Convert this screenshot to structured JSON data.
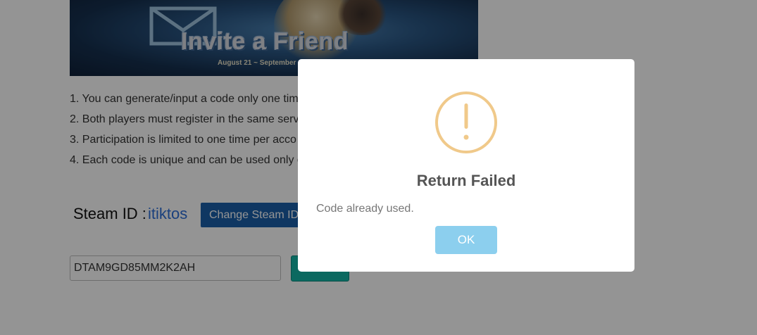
{
  "banner": {
    "title": "Invite a Friend",
    "date": "August 21 ~ September"
  },
  "rules": [
    "1. You can generate/input a code only one tim",
    "2. Both players must register in the same serv",
    "3. Participation is limited to one time per acco",
    "4. Each code is unique and can be used only o"
  ],
  "steam": {
    "label": "Steam ID :",
    "value": "itiktos",
    "change_button": "Change Steam ID"
  },
  "code_input": {
    "value": "DTAM9GD85MM2K2AH"
  },
  "modal": {
    "icon": "warning-exclamation-icon",
    "title": "Return Failed",
    "message": "Code already used.",
    "ok_label": "OK",
    "colors": {
      "icon": "#f0c98a",
      "ok_button": "#8ccfee"
    }
  }
}
